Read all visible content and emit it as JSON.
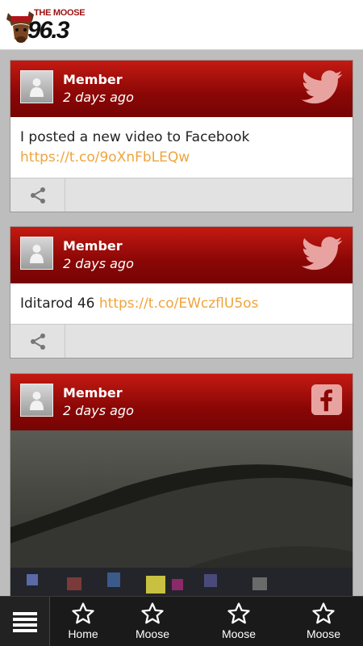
{
  "header": {
    "logo_small_text": "THE MOOSE",
    "logo_frequency": "96.3"
  },
  "feed": {
    "posts": [
      {
        "author": "Member",
        "time": "2 days ago",
        "source_icon": "twitter-icon",
        "text": "I posted a new video to Facebook",
        "link": "https://t.co/9oXnFbLEQw"
      },
      {
        "author": "Member",
        "time": "2 days ago",
        "source_icon": "twitter-icon",
        "text": "Iditarod 46",
        "link": "https://t.co/EWczflU5os"
      },
      {
        "author": "Member",
        "time": "2 days ago",
        "source_icon": "facebook-icon",
        "text": "",
        "link": ""
      }
    ]
  },
  "bottom_nav": {
    "menu_icon": "hamburger-menu-icon",
    "items": [
      {
        "label": "Home",
        "icon": "star-icon"
      },
      {
        "label": "Moose",
        "icon": "star-icon"
      },
      {
        "label": "Moose",
        "icon": "star-icon"
      },
      {
        "label": "Moose",
        "icon": "star-icon"
      }
    ]
  },
  "colors": {
    "card_header": "#8a0706",
    "link": "#f0a43c",
    "bottom_bar": "#1a1a1a",
    "page_bg": "#bdbdbd"
  }
}
